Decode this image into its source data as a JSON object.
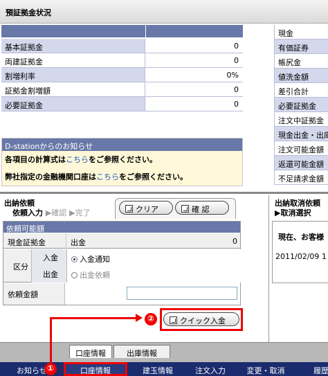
{
  "header": {
    "title": "預証拠金状況"
  },
  "deposit_table": {
    "rows": [
      {
        "label": "基本証拠金",
        "value": "0"
      },
      {
        "label": "両建証拠金",
        "value": "0"
      },
      {
        "label": "割増利率",
        "value": "0%"
      },
      {
        "label": "証拠金割増額",
        "value": "0"
      },
      {
        "label": "必要証拠金",
        "value": "0"
      }
    ]
  },
  "right_panel": {
    "items": [
      "現金",
      "有価証券",
      "帳尻金",
      "値洗金額",
      "差引合計",
      "必要証拠金",
      "注文中証拠金",
      "現金出金・出庫",
      "注文可能金額",
      "返還可能金額",
      "不足請求金額"
    ]
  },
  "notice": {
    "title": "D-stationからのお知らせ",
    "line1_prefix": "各項目の計算式は",
    "line1_link": "こちら",
    "line1_suffix": "をご参照ください。",
    "line2_prefix": "弊社指定の金融機関口座は",
    "line2_link": "こちら",
    "line2_suffix": "をご参照ください。"
  },
  "request_panel": {
    "title": "出納依頼",
    "steps": {
      "current": "依頼入力",
      "step2": "▶確認",
      "step3": "▶完了"
    },
    "clear_label": "クリア",
    "confirm_label": "確 認",
    "section_title": "依頼可能額",
    "cash_deposit_label": "現金証拠金",
    "withdraw_label": "出金",
    "withdraw_value": "0",
    "category_label": "区分",
    "deposit_label": "入金",
    "deposit_option": "入金通知",
    "withdraw_row_label": "出金",
    "withdraw_option": "出金依頼",
    "amount_label": "依頼金額",
    "amount_value": "",
    "quick_deposit_label": "クイック入金"
  },
  "cancel_panel": {
    "title": "出納取消依頼",
    "step": "取消選択",
    "message": "現在、お客様",
    "date": "2011/02/09 1"
  },
  "tabs": {
    "account_info": "口座情報",
    "delivery_info": "出庫情報"
  },
  "bottom_nav": {
    "items": [
      "お知らせ",
      "口座情報",
      "建玉情報",
      "注文入力",
      "変更・取消",
      "履歴"
    ]
  },
  "annotations": {
    "marker1": "①",
    "marker2": "②"
  },
  "colors": {
    "table_header": "#6878a8",
    "row_blue": "#d4d8ec",
    "nav_bg": "#1a2c6e",
    "highlight": "#e00000",
    "notice_bg": "#fff8d8"
  }
}
